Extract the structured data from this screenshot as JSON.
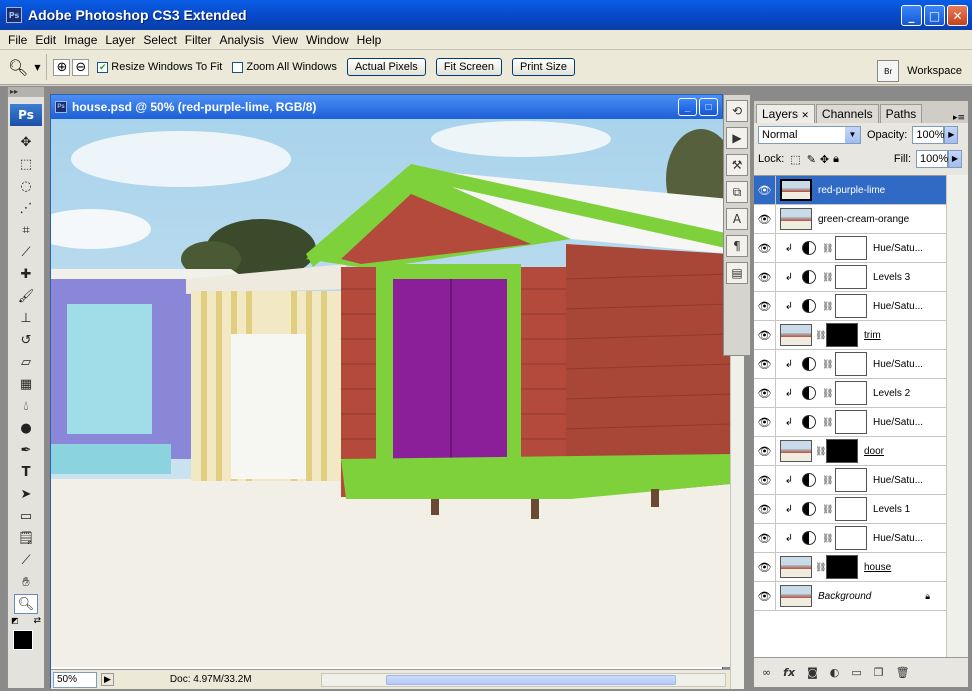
{
  "app": {
    "title": "Adobe Photoshop CS3 Extended",
    "icon_text": "Ps"
  },
  "menu": [
    "File",
    "Edit",
    "Image",
    "Layer",
    "Select",
    "Filter",
    "Analysis",
    "View",
    "Window",
    "Help"
  ],
  "options": {
    "resize_windows": "Resize Windows To Fit",
    "zoom_all": "Zoom All Windows",
    "buttons": [
      "Actual Pixels",
      "Fit Screen",
      "Print Size"
    ],
    "workspace": "Workspace",
    "resize_checked": true,
    "zoom_all_checked": false
  },
  "document": {
    "title": "house.psd @ 50% (red-purple-lime, RGB/8)",
    "zoom": "50%",
    "doc_info": "Doc: 4.97M/33.2M"
  },
  "layers_panel": {
    "tabs": [
      "Layers",
      "Channels",
      "Paths"
    ],
    "blend_mode": "Normal",
    "opacity_label": "Opacity:",
    "opacity": "100%",
    "lock_label": "Lock:",
    "fill_label": "Fill:",
    "fill": "100%",
    "layers": [
      {
        "name": "red-purple-lime",
        "kind": "image",
        "selected": true
      },
      {
        "name": "green-cream-orange",
        "kind": "image"
      },
      {
        "name": "Hue/Satu...",
        "kind": "adj"
      },
      {
        "name": "Levels 3",
        "kind": "adj"
      },
      {
        "name": "Hue/Satu...",
        "kind": "adj"
      },
      {
        "name": "trim",
        "kind": "masked"
      },
      {
        "name": "Hue/Satu...",
        "kind": "adj"
      },
      {
        "name": "Levels 2",
        "kind": "adj"
      },
      {
        "name": "Hue/Satu...",
        "kind": "adj"
      },
      {
        "name": "door",
        "kind": "masked"
      },
      {
        "name": "Hue/Satu...",
        "kind": "adj"
      },
      {
        "name": "Levels 1",
        "kind": "adj"
      },
      {
        "name": "Hue/Satu...",
        "kind": "adj"
      },
      {
        "name": "house",
        "kind": "masked"
      },
      {
        "name": "Background",
        "kind": "background"
      }
    ]
  },
  "colors": {
    "title_blue": "#0647c4",
    "selection": "#316ac5",
    "red_house": "#b34a3c",
    "lime": "#7ed13a",
    "purple": "#8b1f9a"
  }
}
